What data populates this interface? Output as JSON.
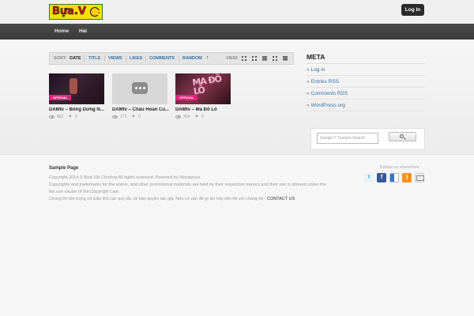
{
  "header": {
    "logo_text": "Bựa.V",
    "login_label": "Log In"
  },
  "nav": {
    "items": [
      {
        "label": "Home"
      },
      {
        "label": "Hài"
      }
    ]
  },
  "sortbar": {
    "sort_label": "SORT:",
    "options": [
      "DATE",
      "TITLE",
      "VIEWS",
      "LIKES",
      "COMMENTS",
      "RANDOM"
    ],
    "active": "DATE",
    "view_label": "VIEW:"
  },
  "videos": [
    {
      "title": "DAMtv – Bống Dưng N...",
      "views": "862",
      "likes": "0",
      "badge": "OFFICIAL"
    },
    {
      "title": "DAMtv – Chấu Hoan Cu...",
      "views": "171",
      "likes": "0",
      "badge": ""
    },
    {
      "title": "DAMtv – Ma Đô Lô",
      "views": "314",
      "likes": "0",
      "badge": "OFFICIAL",
      "art": "MA ĐÔ LÔ"
    }
  ],
  "sidebar": {
    "title": "META",
    "items": [
      "Log in",
      "Entries RSS",
      "Comments RSS",
      "WordPress.org"
    ],
    "search_placeholder": "Google™ Custom Search"
  },
  "footer": {
    "sample_page": "Sample Page",
    "copyright": "Copyright 2014 © Bựa Vãi Chưởng All rights reserved. Powered by Wordpress",
    "trademark_1": "Copyrights and trademarks for the anime, and other promotional materials are held by their respective owners and their use is allowed under the",
    "trademark_2": "fair use clause of the Copyright Law.",
    "vi_note": "Chúng tôi tôn trọng và tuân thủ các quy tắc về bản quyền tác giả. Nếu có vấn đề gì xin hãy liên hệ với chúng tôi : ",
    "contact": "CONTACT US",
    "follow": "Follow us elsewhere"
  },
  "social": {
    "twitter": "t",
    "facebook": "f",
    "rss": ")"
  },
  "colors": {
    "accent": "#2f6fa5",
    "navbar": "#404040",
    "badge": "#e0267c"
  }
}
